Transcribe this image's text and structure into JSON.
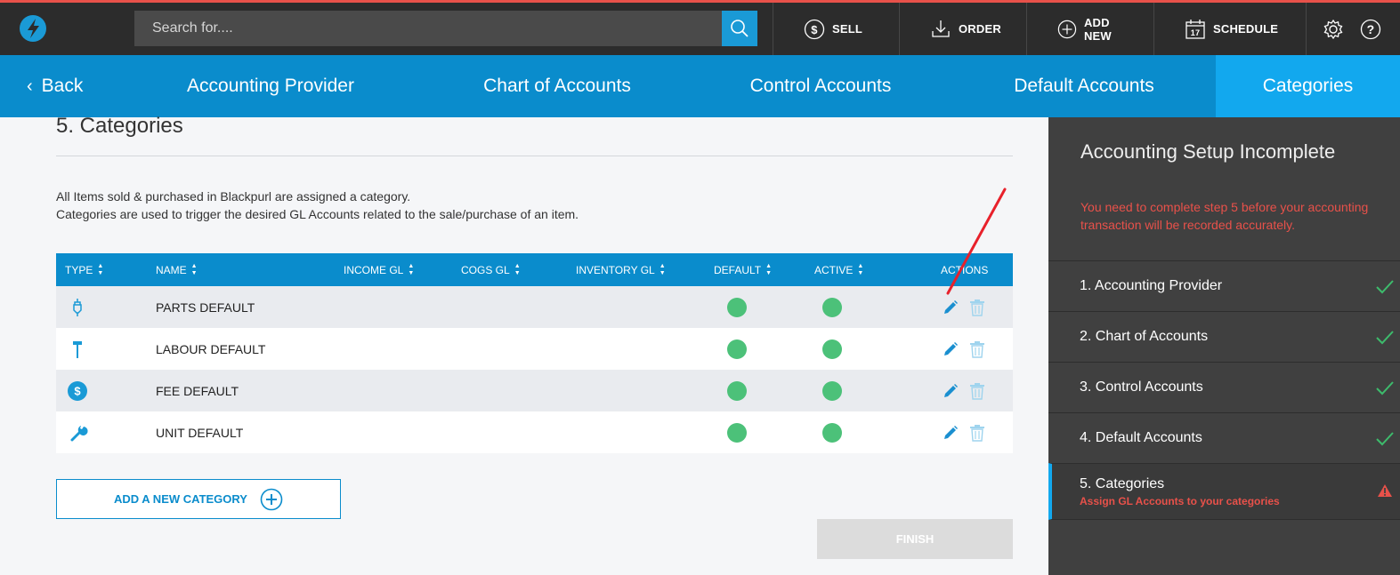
{
  "topbar": {
    "search_placeholder": "Search for....",
    "actions": [
      {
        "label": "SELL",
        "icon": "dollar-icon"
      },
      {
        "label": "ORDER",
        "icon": "download-icon"
      },
      {
        "label": "ADD NEW",
        "icon": "plus-circle-icon"
      },
      {
        "label": "SCHEDULE",
        "icon": "calendar-icon",
        "calendar_day": "17"
      }
    ]
  },
  "nav": {
    "back": "Back",
    "tabs": [
      "Accounting Provider",
      "Chart of Accounts",
      "Control Accounts",
      "Default Accounts",
      "Categories"
    ],
    "active": "Categories"
  },
  "main": {
    "title": "5. Categories",
    "description": [
      "All Items sold & purchased in Blackpurl are assigned a category.",
      "Categories are used to trigger the desired GL Accounts related to the sale/purchase of an item."
    ],
    "columns": [
      "TYPE",
      "NAME",
      "INCOME GL",
      "COGS GL",
      "INVENTORY GL",
      "DEFAULT",
      "ACTIVE",
      "ACTIONS"
    ],
    "rows": [
      {
        "type_icon": "spark-plug-icon",
        "name": "PARTS DEFAULT",
        "default": true,
        "active": true
      },
      {
        "type_icon": "hammer-icon",
        "name": "LABOUR DEFAULT",
        "default": true,
        "active": true
      },
      {
        "type_icon": "dollar-circle-icon",
        "name": "FEE DEFAULT",
        "default": true,
        "active": true,
        "icon_text": "$"
      },
      {
        "type_icon": "wrench-icon",
        "name": "UNIT DEFAULT",
        "default": true,
        "active": true
      }
    ],
    "add_button": "ADD A NEW CATEGORY",
    "finish_button": "FINISH"
  },
  "panel": {
    "title": "Accounting Setup Incomplete",
    "warning": "You need to complete step 5 before your accounting transaction will be recorded accurately.",
    "steps": [
      {
        "label": "1. Accounting Provider",
        "complete": true
      },
      {
        "label": "2. Chart of Accounts",
        "complete": true
      },
      {
        "label": "3. Control Accounts",
        "complete": true
      },
      {
        "label": "4. Default Accounts",
        "complete": true
      },
      {
        "label": "5. Categories",
        "complete": false,
        "sub": "Assign GL Accounts to your categories"
      }
    ]
  },
  "colors": {
    "accent": "#0a8ccc",
    "nav_active": "#12a8ee",
    "warning": "#e8514a",
    "status_green": "#4cc179",
    "annotation": "#e8212b"
  }
}
